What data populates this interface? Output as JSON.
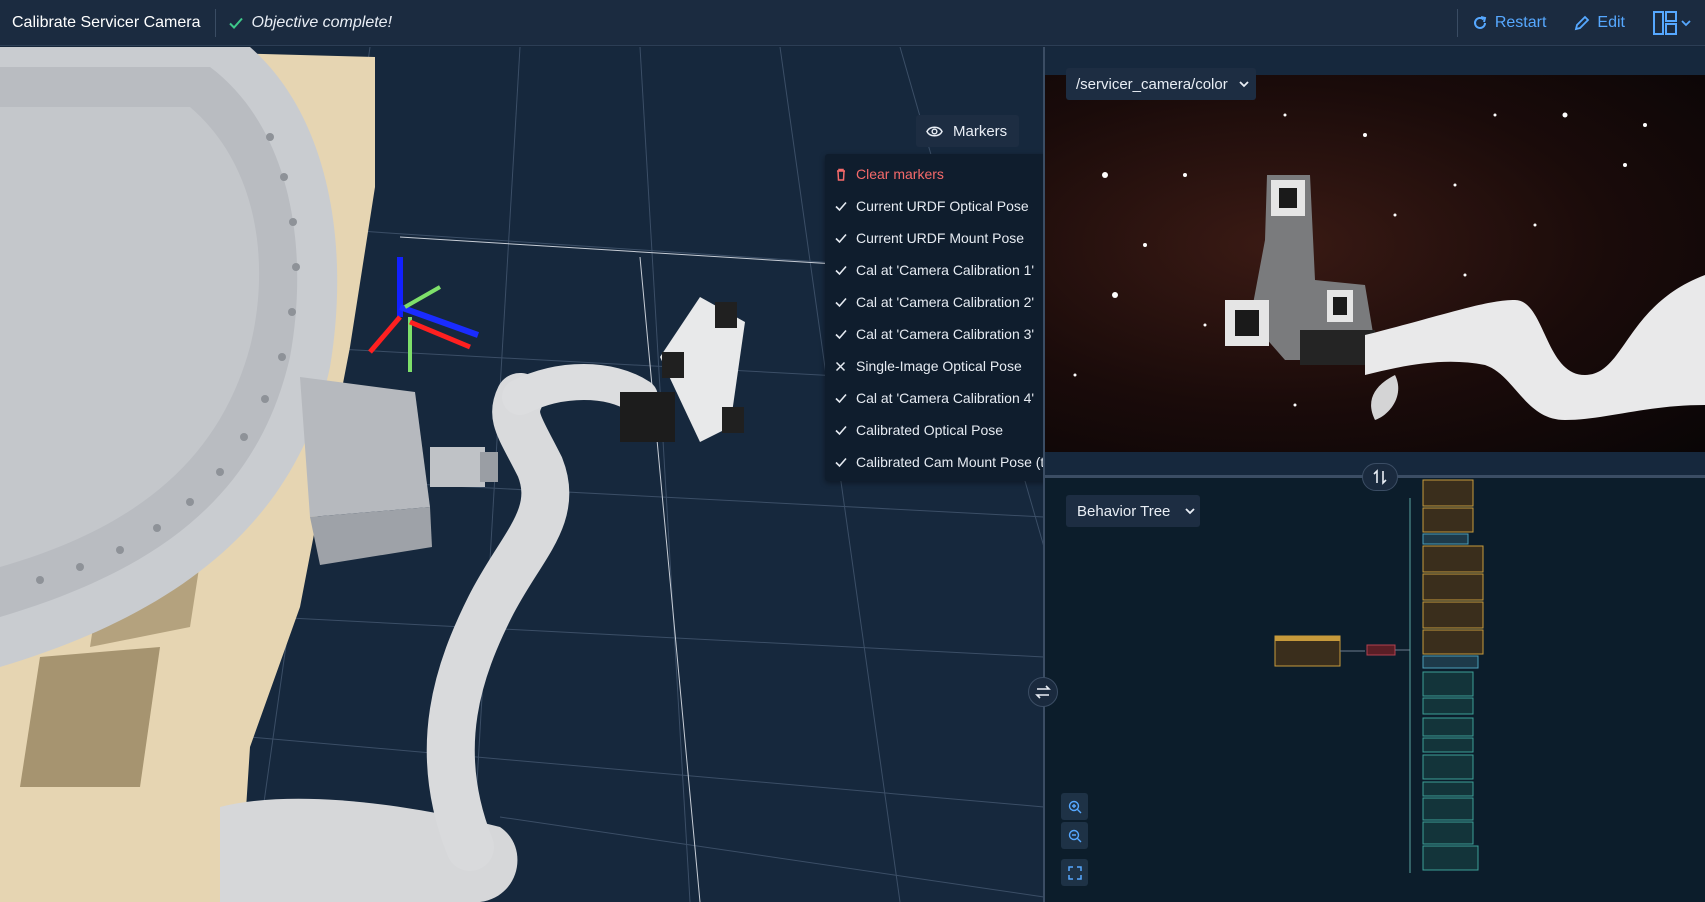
{
  "header": {
    "title": "Calibrate Servicer Camera",
    "status": "Objective complete!",
    "restart_label": "Restart",
    "edit_label": "Edit"
  },
  "viewport": {
    "markers_label": "Markers",
    "menu": [
      {
        "label": "Clear markers",
        "icon": "trash-icon",
        "danger": true
      },
      {
        "label": "Current URDF Optical Pose",
        "icon": "check-icon"
      },
      {
        "label": "Current URDF Mount Pose",
        "icon": "check-icon"
      },
      {
        "label": "Cal at 'Camera Calibration 1'",
        "icon": "check-icon"
      },
      {
        "label": "Cal at 'Camera Calibration 2'",
        "icon": "check-icon"
      },
      {
        "label": "Cal at 'Camera Calibration 3'",
        "icon": "check-icon"
      },
      {
        "label": "Single-Image Optical Pose",
        "icon": "x-icon"
      },
      {
        "label": "Cal at 'Camera Calibration 4'",
        "icon": "check-icon"
      },
      {
        "label": "Calibrated Optical Pose",
        "icon": "check-icon"
      },
      {
        "label": "Calibrated Cam Mount Pose (to file)",
        "icon": "check-icon"
      }
    ]
  },
  "camera": {
    "topic": "/servicer_camera/color"
  },
  "behavior_tree": {
    "view_label": "Behavior Tree"
  },
  "colors": {
    "accent": "#56a8ff",
    "success": "#3ec98a",
    "danger": "#f56a6a"
  }
}
